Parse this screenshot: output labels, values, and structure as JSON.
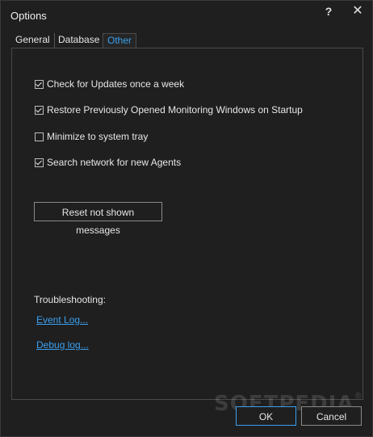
{
  "window": {
    "title": "Options",
    "help_label": "?",
    "close_label": "✕"
  },
  "tabs": [
    {
      "label": "General",
      "active": false
    },
    {
      "label": "Database",
      "active": false
    },
    {
      "label": "Other",
      "active": true
    }
  ],
  "options": [
    {
      "label": "Check for Updates once a week",
      "checked": true
    },
    {
      "label": "Restore Previously Opened Monitoring Windows on Startup",
      "checked": true
    },
    {
      "label": "Minimize to system tray",
      "checked": false
    },
    {
      "label": "Search network for new Agents",
      "checked": true
    }
  ],
  "reset_button_label": "Reset not shown messages",
  "troubleshooting": {
    "heading": "Troubleshooting:",
    "event_log_label": "Event Log...",
    "debug_log_label": "Debug log..."
  },
  "footer": {
    "ok_label": "OK",
    "cancel_label": "Cancel"
  },
  "watermark": {
    "text": "SOFTPEDIA",
    "mark": "®"
  },
  "colors": {
    "accent": "#3a9ff0",
    "background": "#1f1f1f",
    "text": "#e6e6e6"
  }
}
